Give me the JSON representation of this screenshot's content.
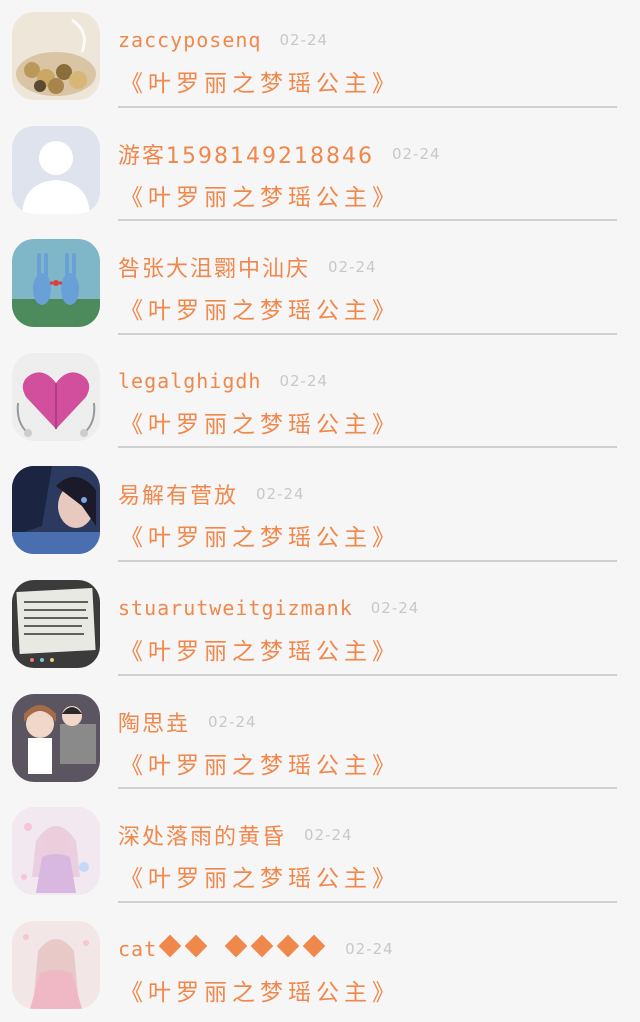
{
  "comments": [
    {
      "name": "zaccyposenq",
      "date": "02-24",
      "title": "《叶罗丽之梦瑶公主》",
      "avatar": "coins-icon"
    },
    {
      "name": "游客1598149218846",
      "date": "02-24",
      "title": "《叶罗丽之梦瑶公主》",
      "avatar": "default-user-icon"
    },
    {
      "name": "咎张大沮翾中汕庆",
      "date": "02-24",
      "title": "《叶罗丽之梦瑶公主》",
      "avatar": "bunnies-icon"
    },
    {
      "name": "legalghigdh",
      "date": "02-24",
      "title": "《叶罗丽之梦瑶公主》",
      "avatar": "heart-earphones-icon"
    },
    {
      "name": "易解有菅放",
      "date": "02-24",
      "title": "《叶罗丽之梦瑶公主》",
      "avatar": "girl-blue-icon"
    },
    {
      "name": "stuarutweitgizmank",
      "date": "02-24",
      "title": "《叶罗丽之梦瑶公主》",
      "avatar": "notebook-icon"
    },
    {
      "name": "陶思垚",
      "date": "02-24",
      "title": "《叶罗丽之梦瑶公主》",
      "avatar": "anime-couple-icon"
    },
    {
      "name": "深处落雨的黄昏",
      "date": "02-24",
      "title": "《叶罗丽之梦瑶公主》",
      "avatar": "anime-girl-pink-icon"
    },
    {
      "name": "cat",
      "name_unknown_glyphs": 6,
      "date": "02-24",
      "title": "《叶罗丽之梦瑶公主》",
      "avatar": "anime-girl-light-icon"
    }
  ],
  "colors": {
    "accent": "#f0874b",
    "date": "#c8c8c8",
    "divider": "#cfcfcf",
    "background": "#f6f6f6"
  }
}
